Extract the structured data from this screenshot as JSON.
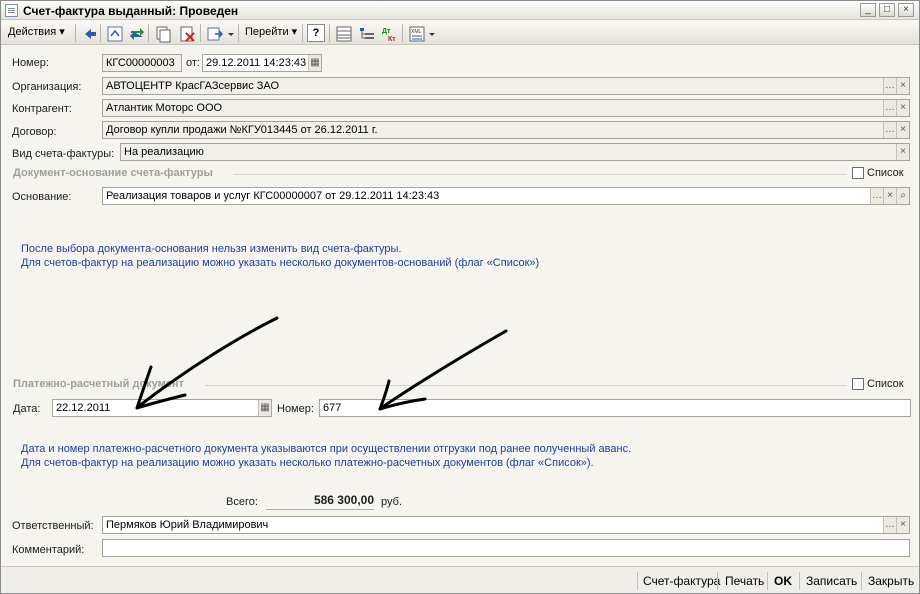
{
  "window": {
    "title": "Счет-фактура выданный: Проведен",
    "buttons": {
      "minimize": "_",
      "maximize": "□",
      "close": "×"
    }
  },
  "toolbar": {
    "actions_label": "Действия",
    "goto_label": "Перейти",
    "help_label": "?",
    "icons": [
      "back-icon",
      "refresh-icon",
      "swap-icon",
      "copy-icon",
      "delete-icon",
      "move-icon",
      "help-icon",
      "structure-icon",
      "tree-icon",
      "dt-kt-icon",
      "xml-icon"
    ]
  },
  "header": {
    "number_label": "Номер:",
    "number_value": "КГС00000003",
    "from_label": "от:",
    "date_value": "29.12.2011 14:23:43"
  },
  "fields": {
    "org_label": "Организация:",
    "org_value": "АВТОЦЕНТР КрасГАЗсервис ЗАО",
    "contractor_label": "Контрагент:",
    "contractor_value": "Атлантик Моторс ООО",
    "contract_label": "Договор:",
    "contract_value": "Договор купли продажи №КГУ013445 от 26.12.2011 г.",
    "invoice_type_label": "Вид счета-фактуры:",
    "invoice_type_value": "На реализацию"
  },
  "basis_section": {
    "title": "Документ-основание счета-фактуры",
    "list_label": "Список",
    "basis_label": "Основание:",
    "basis_value": "Реализация товаров и услуг КГС00000007 от 29.12.2011 14:23:43",
    "hint_line1": "После выбора документа-основания нельзя изменить вид счета-фактуры.",
    "hint_line2": "Для счетов-фактур на реализацию можно указать несколько документов-оснований (флаг «Список»)"
  },
  "payment_section": {
    "title": "Платежно-расчетный документ",
    "list_label": "Список",
    "date_label": "Дата:",
    "date_value": "22.12.2011",
    "number_label": "Номер:",
    "number_value": "677",
    "hint_line1": "Дата и номер платежно-расчетного документа указываются при осуществлении отгрузки под ранее полученный аванс.",
    "hint_line2": "Для счетов-фактур на реализацию можно указать несколько платежно-расчетных документов (флаг «Список»)."
  },
  "totals": {
    "total_label": "Всего:",
    "total_value": "586 300,00",
    "currency": "руб."
  },
  "footer_fields": {
    "responsible_label": "Ответственный:",
    "responsible_value": "Пермяков Юрий Владимирович",
    "comment_label": "Комментарий:",
    "comment_value": ""
  },
  "bottom_buttons": {
    "invoice": "Счет-фактура",
    "print": "Печать",
    "ok": "OK",
    "save": "Записать",
    "close": "Закрыть"
  }
}
